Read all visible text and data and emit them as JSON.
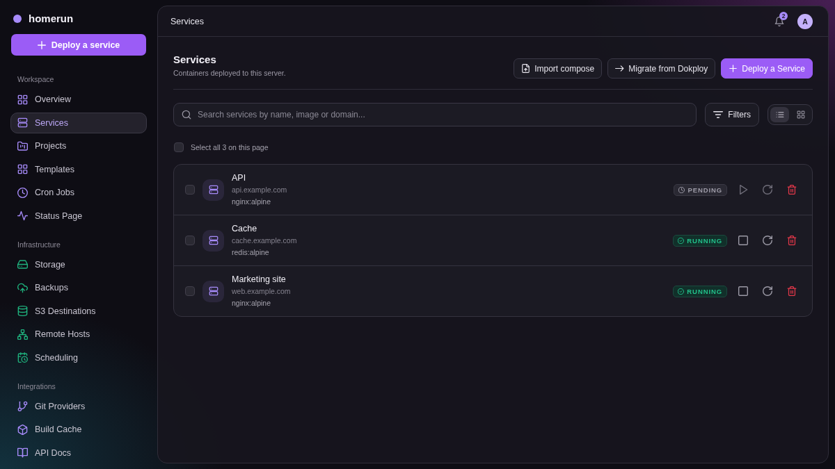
{
  "sidebar": {
    "brand": "homerun",
    "deploy_button": "Deploy a service",
    "groups": [
      {
        "label": "Workspace",
        "color": "#a78bfa",
        "items": [
          {
            "label": "Overview",
            "selected": false
          },
          {
            "label": "Services",
            "selected": true
          },
          {
            "label": "Projects",
            "selected": false
          },
          {
            "label": "Templates",
            "selected": false
          },
          {
            "label": "Cron Jobs",
            "selected": false
          },
          {
            "label": "Status Page",
            "selected": false
          }
        ]
      },
      {
        "label": "Infrastructure",
        "color": "#1fb37e",
        "items": [
          {
            "label": "Storage",
            "selected": false
          },
          {
            "label": "Backups",
            "selected": false
          },
          {
            "label": "S3 Destinations",
            "selected": false
          },
          {
            "label": "Remote Hosts",
            "selected": false
          },
          {
            "label": "Scheduling",
            "selected": false
          }
        ]
      },
      {
        "label": "Integrations",
        "color": "#a78bfa",
        "items": [
          {
            "label": "Git Providers",
            "selected": false
          },
          {
            "label": "Build Cache",
            "selected": false
          },
          {
            "label": "API Docs",
            "selected": false
          }
        ]
      }
    ]
  },
  "header": {
    "title": "Services",
    "notifications": "2",
    "avatar": "A"
  },
  "page": {
    "title": "Services",
    "subtitle": "Containers deployed to this server.",
    "actions": [
      {
        "label": "Import compose",
        "kind": "secondary"
      },
      {
        "label": "Migrate from Dokploy",
        "kind": "secondary"
      },
      {
        "label": "Deploy a Service",
        "kind": "primary"
      }
    ]
  },
  "toolbar": {
    "search": {
      "placeholder": "Search services by name, image or domain..."
    },
    "filters": "Filters",
    "views": [
      {
        "selected": true
      },
      {
        "selected": false
      }
    ]
  },
  "select_all": {
    "label": "Select all 3 on this page",
    "checked": false
  },
  "services": [
    {
      "name": "API",
      "domain": "api.example.com",
      "image": "nginx:alpine",
      "status": "PENDING",
      "kind": "pending",
      "checked": false
    },
    {
      "name": "Cache",
      "domain": "cache.example.com",
      "image": "redis:alpine",
      "status": "RUNNING",
      "kind": "running",
      "checked": false
    },
    {
      "name": "Marketing site",
      "domain": "web.example.com",
      "image": "nginx:alpine",
      "status": "RUNNING",
      "kind": "running",
      "checked": false
    }
  ]
}
